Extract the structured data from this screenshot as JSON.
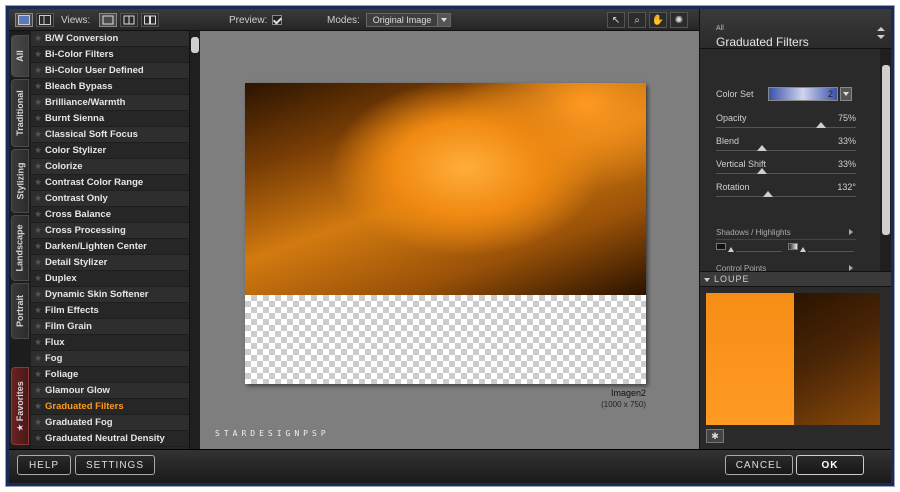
{
  "toolbar": {
    "views_label": "Views:",
    "preview_label": "Preview:",
    "modes_label": "Modes:",
    "mode_value": "Original Image"
  },
  "vertical_tabs": [
    {
      "label": "All"
    },
    {
      "label": "Traditional"
    },
    {
      "label": "Stylizing"
    },
    {
      "label": "Landscape"
    },
    {
      "label": "Portrait"
    },
    {
      "label": "Favorites"
    }
  ],
  "filters": [
    {
      "label": "B/W Conversion"
    },
    {
      "label": "Bi-Color Filters"
    },
    {
      "label": "Bi-Color User Defined"
    },
    {
      "label": "Bleach Bypass"
    },
    {
      "label": "Brilliance/Warmth"
    },
    {
      "label": "Burnt Sienna"
    },
    {
      "label": "Classical Soft Focus"
    },
    {
      "label": "Color Stylizer"
    },
    {
      "label": "Colorize"
    },
    {
      "label": "Contrast Color Range"
    },
    {
      "label": "Contrast Only"
    },
    {
      "label": "Cross Balance"
    },
    {
      "label": "Cross Processing"
    },
    {
      "label": "Darken/Lighten Center"
    },
    {
      "label": "Detail Stylizer"
    },
    {
      "label": "Duplex"
    },
    {
      "label": "Dynamic Skin Softener"
    },
    {
      "label": "Film Effects"
    },
    {
      "label": "Film Grain"
    },
    {
      "label": "Flux"
    },
    {
      "label": "Fog"
    },
    {
      "label": "Foliage"
    },
    {
      "label": "Glamour Glow"
    },
    {
      "label": "Graduated Filters"
    },
    {
      "label": "Graduated Fog"
    },
    {
      "label": "Graduated Neutral Density"
    }
  ],
  "selected_filter": "Graduated Filters",
  "preview": {
    "image_name": "Imagen2",
    "image_size": "(1000 x 750)",
    "watermark": "STARDESIGNPSP"
  },
  "panel": {
    "category": "All",
    "title": "Graduated Filters",
    "color_set_label": "Color Set",
    "color_set_value": "2",
    "controls": [
      {
        "label": "Opacity",
        "value": "75%",
        "level": 0.75
      },
      {
        "label": "Blend",
        "value": "33%",
        "level": 0.33
      },
      {
        "label": "Vertical Shift",
        "value": "33%",
        "level": 0.33
      },
      {
        "label": "Rotation",
        "value": "132°",
        "level": 0.37
      }
    ],
    "shadows_label": "Shadows / Highlights",
    "control_points_label": "Control Points",
    "loupe_label": "LOUPE"
  },
  "buttons": {
    "help": "HELP",
    "settings": "SETTINGS",
    "cancel": "CANCEL",
    "ok": "OK"
  },
  "colors": {
    "accent": "#ff9a1f",
    "frame": "#1c2a55"
  }
}
